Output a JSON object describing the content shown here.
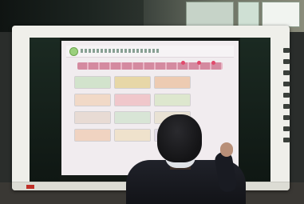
{
  "image": {
    "description_colors": {
      "screen_background": "#f1ecef",
      "nav_bar": "#d48aa0",
      "bezel": "#efefea",
      "brand_mark": "#c03028"
    },
    "icons": [
      "logo-circle-icon",
      "nav-dot-icon"
    ]
  }
}
